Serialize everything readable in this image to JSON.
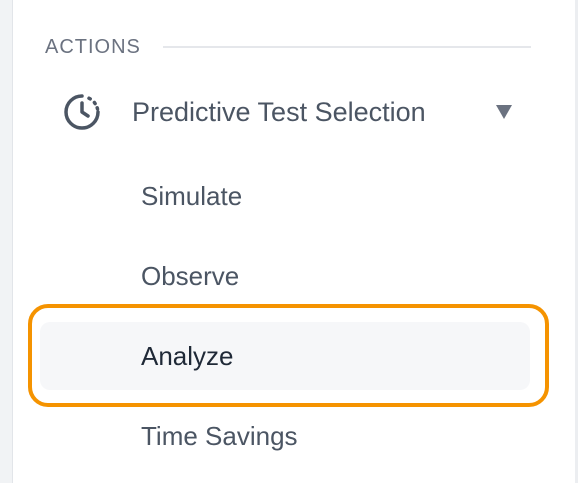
{
  "section": {
    "title": "ACTIONS"
  },
  "group": {
    "label": "Predictive Test Selection",
    "icon": "clock-dashed-icon",
    "expanded": true
  },
  "items": [
    {
      "label": "Simulate",
      "active": false
    },
    {
      "label": "Observe",
      "active": false
    },
    {
      "label": "Analyze",
      "active": true
    },
    {
      "label": "Time Savings",
      "active": false
    }
  ],
  "colors": {
    "highlight": "#f59300",
    "text": "#4b5563",
    "active_text": "#1f2937",
    "active_bg": "#f6f7f9"
  }
}
